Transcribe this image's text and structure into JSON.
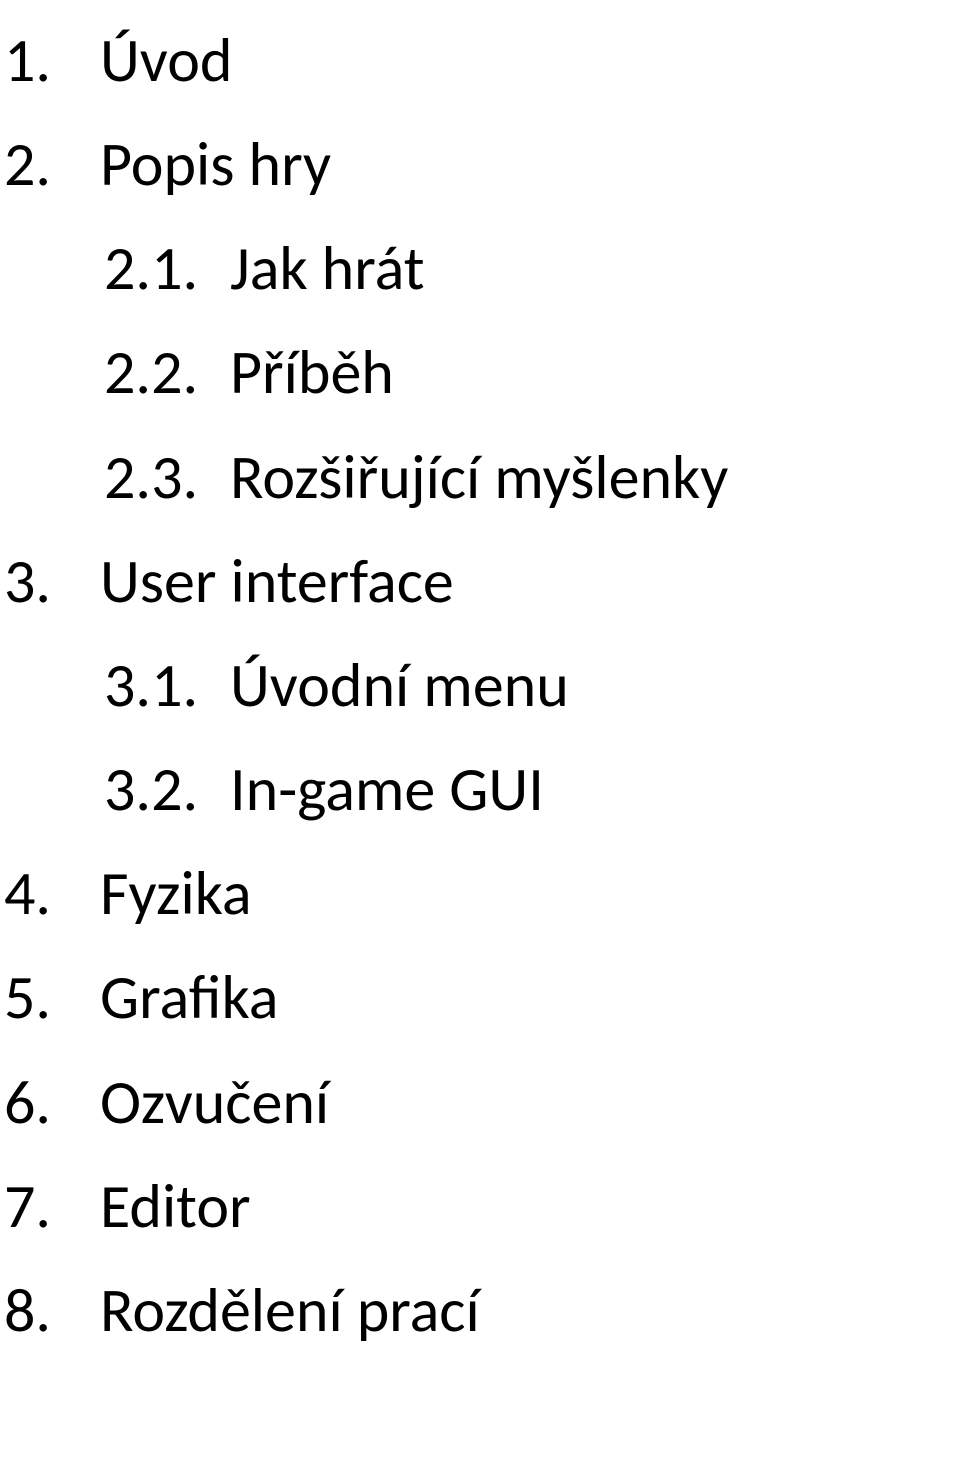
{
  "items": [
    {
      "num": "1.",
      "label": "Úvod",
      "children": []
    },
    {
      "num": "2.",
      "label": "Popis hry",
      "children": [
        {
          "num": "2.1.",
          "label": "Jak hrát"
        },
        {
          "num": "2.2.",
          "label": "Příběh"
        },
        {
          "num": "2.3.",
          "label": "Rozšiřující myšlenky"
        }
      ]
    },
    {
      "num": "3.",
      "label": "User interface",
      "children": [
        {
          "num": "3.1.",
          "label": "Úvodní menu"
        },
        {
          "num": "3.2.",
          "label": "In-game GUI"
        }
      ]
    },
    {
      "num": "4.",
      "label": "Fyzika",
      "children": []
    },
    {
      "num": "5.",
      "label": "Grafika",
      "children": []
    },
    {
      "num": "6.",
      "label": "Ozvučení",
      "children": []
    },
    {
      "num": "7.",
      "label": "Editor",
      "children": []
    },
    {
      "num": "8.",
      "label": "Rozdělení prací",
      "children": []
    }
  ]
}
